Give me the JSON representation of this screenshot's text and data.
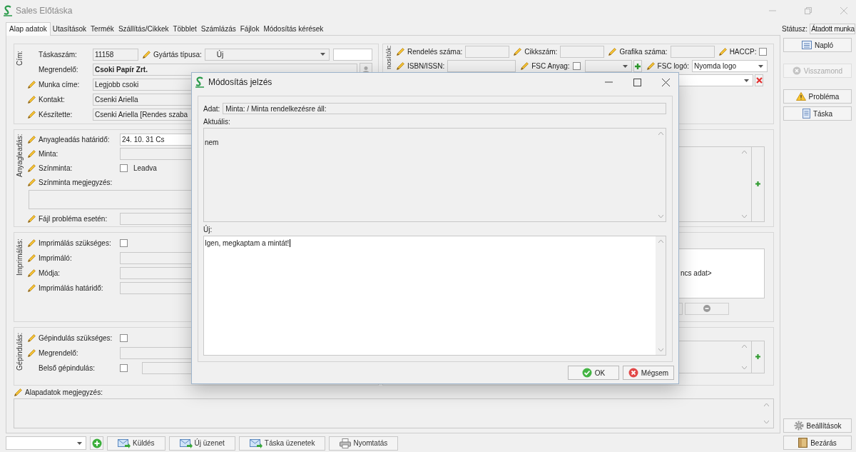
{
  "window": {
    "title": "Sales Előtáska"
  },
  "tabs": [
    {
      "label": "Alap adatok",
      "selected": true
    },
    {
      "label": "Utasítások",
      "selected": false
    },
    {
      "label": "Termék",
      "selected": false
    },
    {
      "label": "Szállítás/Cikkek",
      "selected": false
    },
    {
      "label": "Többlet",
      "selected": false
    },
    {
      "label": "Számlázás",
      "selected": false
    },
    {
      "label": "Fájlok",
      "selected": false
    },
    {
      "label": "Módosítás kérések",
      "selected": false
    }
  ],
  "status": {
    "label": "Státusz:",
    "value": "Átadott munka"
  },
  "cim": {
    "title": "Cím:",
    "task_number": {
      "label": "Táskaszám:",
      "value": "11158"
    },
    "production_type": {
      "label": "Gyártás típusa:",
      "value": "Új"
    },
    "rows": [
      {
        "kind": "lookup",
        "label": "Megrendelő:",
        "editable": false,
        "bold": true,
        "value": "Csoki Papír Zrt."
      },
      {
        "kind": "text",
        "label": "Munka címe:",
        "editable": true,
        "bold": false,
        "value": "Legjobb csoki"
      },
      {
        "kind": "text",
        "label": "Kontakt:",
        "editable": true,
        "bold": false,
        "value": "Csenki Ariella"
      },
      {
        "kind": "text",
        "label": "Készítette:",
        "editable": true,
        "bold": false,
        "value": "Csenki Ariella [Rendes szaba"
      }
    ]
  },
  "left_groups": [
    {
      "title": "Anyagleadás:",
      "rows": [
        {
          "kind": "combo",
          "label": "Anyagleadás határidő:",
          "editable": true,
          "value": "24. 10. 31 Cs"
        },
        {
          "kind": "combo",
          "label": "Minta:",
          "editable": true
        },
        {
          "kind": "check",
          "label": "Színminta:",
          "editable": true,
          "checked": false,
          "check_label": "Leadva"
        },
        {
          "kind": "note",
          "label": "Színminta megjegyzés:",
          "editable": true
        },
        {
          "kind": "text",
          "label": "Fájl probléma esetén:",
          "editable": true
        }
      ]
    },
    {
      "title": "Imprimálás:",
      "rows": [
        {
          "kind": "check",
          "label": "Imprimálás szükséges:",
          "editable": true,
          "checked": false
        },
        {
          "kind": "text",
          "label": "Imprimáló:",
          "editable": true
        },
        {
          "kind": "text",
          "label": "Módja:",
          "editable": true
        },
        {
          "kind": "text",
          "label": "Imprimálás határidő:",
          "editable": true
        }
      ]
    },
    {
      "title": "Gépindulás:",
      "rows": [
        {
          "kind": "check",
          "label": "Gépindulás szükséges:",
          "editable": true,
          "checked": false
        },
        {
          "kind": "text",
          "label": "Megrendelő:",
          "editable": true
        },
        {
          "kind": "check_field",
          "label": "Belső gépindulás:",
          "editable": false,
          "checked": false
        }
      ]
    }
  ],
  "identifiers": {
    "title": "nosítók:",
    "first_line": {
      "order_number": {
        "label": "Rendelés száma:"
      },
      "item_number": {
        "label": "Cikkszám:"
      },
      "graphic_number": {
        "label": "Grafika száma:"
      },
      "haccp": {
        "label": "HACCP:",
        "checked": false
      }
    },
    "second_line": {
      "isbn": {
        "label": "ISBN/ISSN:"
      },
      "fsc_material": {
        "label": "FSC Anyag:",
        "checked": false
      },
      "fsc_logo": {
        "label": "FSC logó:",
        "value": "Nyomda logo"
      }
    }
  },
  "right_list_text": "ncs adat>",
  "notes": {
    "label": "Alapadatok megjegyzés:"
  },
  "bottom_buttons": [
    {
      "label": "Küldés",
      "kind": "mail"
    },
    {
      "label": "Új üzenet",
      "kind": "mail"
    },
    {
      "label": "Táska üzenetek",
      "kind": "mail"
    },
    {
      "label": "Nyomtatás",
      "kind": "printer"
    }
  ],
  "side_buttons": [
    {
      "label": "Napló",
      "kind": "list",
      "disabled": false
    },
    {
      "label": "Visszamond",
      "kind": "cancel",
      "disabled": true
    },
    {
      "label": "Probléma",
      "kind": "warning",
      "disabled": false
    },
    {
      "label": "Táska",
      "kind": "document",
      "disabled": false
    }
  ],
  "side_bottom_buttons": [
    {
      "label": "Beállítások",
      "kind": "gear"
    },
    {
      "label": "Bezárás",
      "kind": "door"
    }
  ],
  "dialog": {
    "title": "Módosítás jelzés",
    "data_label": "Adat:",
    "data_value": "Minta: / Minta rendelkezésre áll:",
    "current_label": "Aktuális:",
    "current_value": "nem",
    "new_label": "Új:",
    "new_value": "Igen, megkaptam a mintát!",
    "buttons": [
      {
        "label": "OK",
        "kind": "ok"
      },
      {
        "label": "Mégsem",
        "kind": "cancel"
      }
    ]
  }
}
